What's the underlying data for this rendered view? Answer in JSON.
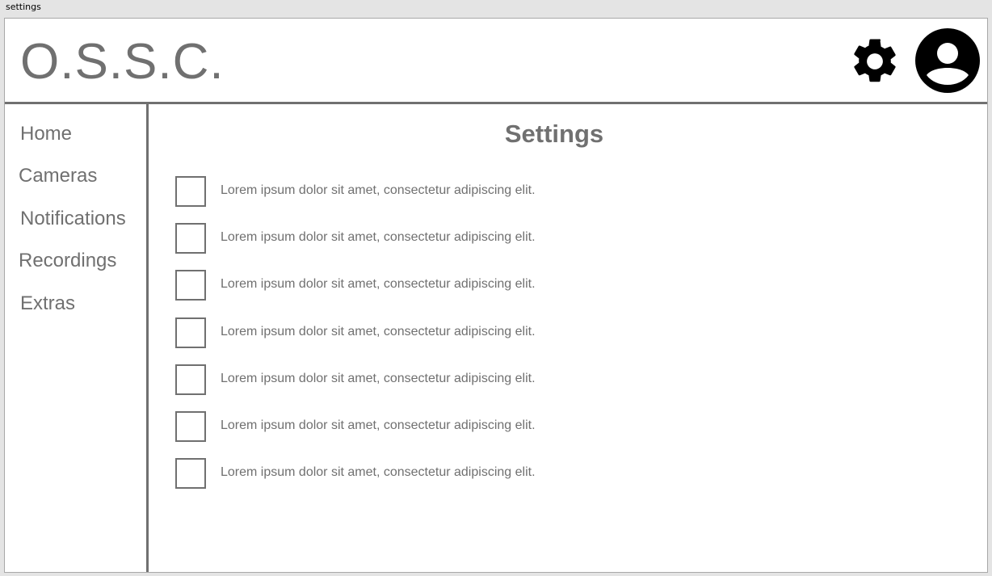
{
  "window_title": "settings",
  "header": {
    "logo": "O.S.S.C."
  },
  "sidebar": {
    "items": [
      {
        "label": "Home"
      },
      {
        "label": "Cameras"
      },
      {
        "label": "Notifications"
      },
      {
        "label": "Recordings"
      },
      {
        "label": "Extras"
      }
    ]
  },
  "main": {
    "title": "Settings",
    "options": [
      {
        "label": "Lorem ipsum dolor sit amet, consectetur adipiscing elit.",
        "checked": false
      },
      {
        "label": "Lorem ipsum dolor sit amet, consectetur adipiscing elit.",
        "checked": false
      },
      {
        "label": "Lorem ipsum dolor sit amet, consectetur adipiscing elit.",
        "checked": false
      },
      {
        "label": "Lorem ipsum dolor sit amet, consectetur adipiscing elit.",
        "checked": false
      },
      {
        "label": "Lorem ipsum dolor sit amet, consectetur adipiscing elit.",
        "checked": false
      },
      {
        "label": "Lorem ipsum dolor sit amet, consectetur adipiscing elit.",
        "checked": false
      },
      {
        "label": "Lorem ipsum dolor sit amet, consectetur adipiscing elit.",
        "checked": false
      }
    ]
  },
  "colors": {
    "text": "#707070",
    "icon": "#000000",
    "border": "#707070"
  }
}
